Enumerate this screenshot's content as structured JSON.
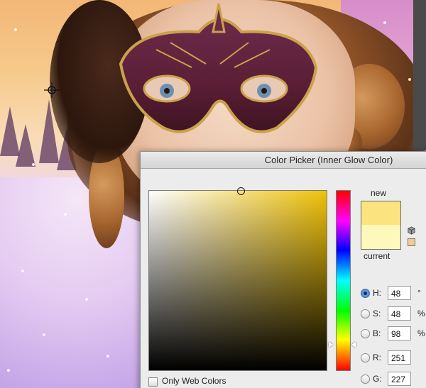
{
  "dialog": {
    "title": "Color Picker (Inner Glow Color)"
  },
  "swatches": {
    "new_label": "new",
    "current_label": "current",
    "new_color": "#fbe37f",
    "current_color": "#fff8bb",
    "websafe_color": "#f5c98f"
  },
  "field": {
    "base_hue_color": "#f0c20a"
  },
  "hsb": [
    {
      "label": "H:",
      "value": "48",
      "unit": "°",
      "selected": true
    },
    {
      "label": "S:",
      "value": "48",
      "unit": "%",
      "selected": false
    },
    {
      "label": "B:",
      "value": "98",
      "unit": "%",
      "selected": false
    }
  ],
  "rgb": [
    {
      "label": "R:",
      "value": "251"
    },
    {
      "label": "G:",
      "value": "227"
    }
  ],
  "options": {
    "only_web_colors_label": "Only Web Colors"
  }
}
